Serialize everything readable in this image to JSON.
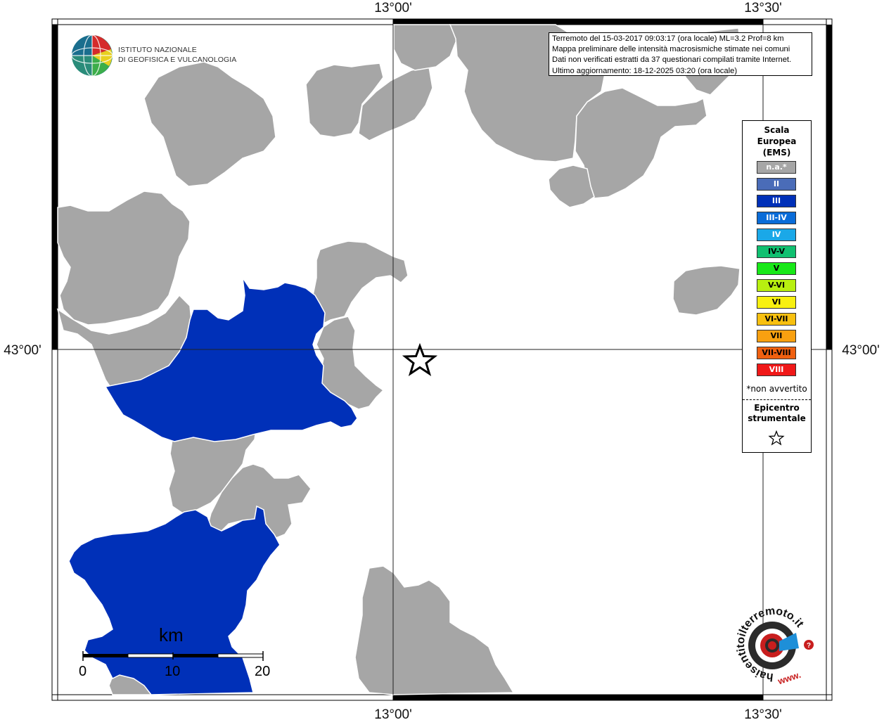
{
  "map": {
    "coord_labels": {
      "top_lon_left": "13°00'",
      "top_lon_right": "13°30'",
      "bottom_lon_left": "13°00'",
      "bottom_lon_right": "13°30'",
      "left_lat": "43°00'",
      "right_lat": "43°00'"
    },
    "colors": {
      "no_data": "#a6a6a6",
      "intensity_III": "#0030b8",
      "background": "#ffffff"
    }
  },
  "info": {
    "lines": [
      "Terremoto del 15-03-2017 09:03:17 (ora locale) ML=3.2 Prof=8 km",
      "Mappa preliminare delle intensità macrosismiche stimate nei comuni",
      "Dati non verificati estratti da 37 questionari compilati tramite Internet.",
      "Ultimo aggiornamento: 18-12-2025 03:20 (ora locale)"
    ]
  },
  "logo_ingv": {
    "line1": "ISTITUTO NAZIONALE",
    "line2": "DI GEOFISICA E VULCANOLOGIA"
  },
  "legend": {
    "title_line1": "Scala",
    "title_line2": "Europea",
    "title_line3": "(EMS)",
    "items": [
      {
        "label": "n.a.*",
        "color": "#a6a6a6",
        "text_color": "#ffffff"
      },
      {
        "label": "II",
        "color": "#4a6cb8",
        "text_color": "#ffffff"
      },
      {
        "label": "III",
        "color": "#0030b8",
        "text_color": "#ffffff"
      },
      {
        "label": "III-IV",
        "color": "#0a6cd8",
        "text_color": "#ffffff"
      },
      {
        "label": "IV",
        "color": "#1aa8e8",
        "text_color": "#ffffff"
      },
      {
        "label": "IV-V",
        "color": "#10c070",
        "text_color": "#000000"
      },
      {
        "label": "V",
        "color": "#18e818",
        "text_color": "#000000"
      },
      {
        "label": "V-VI",
        "color": "#b8f010",
        "text_color": "#000000"
      },
      {
        "label": "VI",
        "color": "#f8f010",
        "text_color": "#000000"
      },
      {
        "label": "VI-VII",
        "color": "#f8c010",
        "text_color": "#000000"
      },
      {
        "label": "VII",
        "color": "#f8a010",
        "text_color": "#000000"
      },
      {
        "label": "VII-VIII",
        "color": "#f06010",
        "text_color": "#000000"
      },
      {
        "label": "VIII",
        "color": "#f01818",
        "text_color": "#ffffff"
      }
    ],
    "note": "*non avvertito",
    "epicentro_line1": "Epicentro",
    "epicentro_line2": "strumentale"
  },
  "scale": {
    "unit": "km",
    "tick_0": "0",
    "tick_10": "10",
    "tick_20": "20"
  },
  "logo_hai": {
    "text": "haisentitoilterremoto.it",
    "www": "www."
  }
}
